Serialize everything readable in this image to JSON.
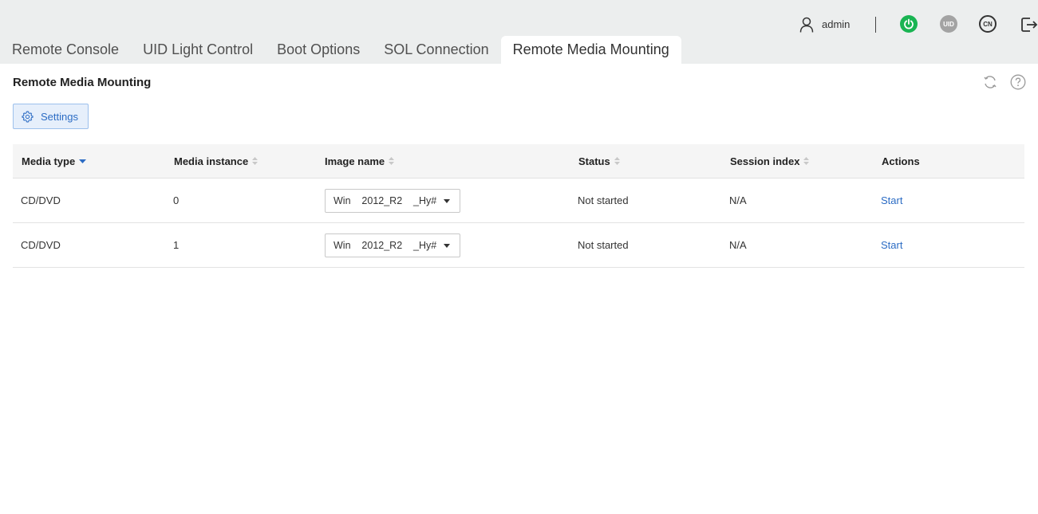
{
  "header": {
    "username": "admin",
    "icons": [
      "user-icon",
      "power-icon",
      "uid-icon",
      "cn-language-icon",
      "logout-icon"
    ],
    "uid_label": "UID",
    "lang_label": "CN",
    "colors": {
      "power": "#19b452",
      "uid": "#a3a3a3"
    }
  },
  "tabs": [
    {
      "label": "Remote Console",
      "active": false
    },
    {
      "label": "UID Light Control",
      "active": false
    },
    {
      "label": "Boot Options",
      "active": false
    },
    {
      "label": "SOL Connection",
      "active": false
    },
    {
      "label": "Remote Media Mounting",
      "active": true
    }
  ],
  "page": {
    "title": "Remote Media Mounting",
    "settings_label": "Settings",
    "accent_color": "#2c6cc4"
  },
  "table": {
    "columns": [
      "Media type",
      "Media instance",
      "Image name",
      "Status",
      "Session index",
      "Actions"
    ],
    "sorted_column": "Media type",
    "rows": [
      {
        "media_type": "CD/DVD",
        "media_instance": "0",
        "image_name": "Win    2012_R2    _Hy#",
        "status": "Not started",
        "session_index": "N/A",
        "action": "Start"
      },
      {
        "media_type": "CD/DVD",
        "media_instance": "1",
        "image_name": "Win    2012_R2    _Hy#",
        "status": "Not started",
        "session_index": "N/A",
        "action": "Start"
      }
    ]
  }
}
